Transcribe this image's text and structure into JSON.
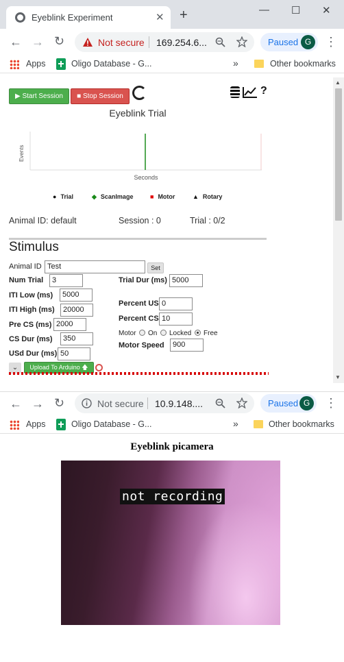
{
  "window1": {
    "tab_title": "Eyeblink Experiment",
    "tab_close": "✕",
    "new_tab": "+",
    "controls": {
      "minimize": "—",
      "maximize": "☐",
      "close": "✕"
    },
    "nav": {
      "back": "←",
      "forward": "→",
      "reload": "↻"
    },
    "omnibox": {
      "security_label": "Not secure",
      "url": "169.254.6..."
    },
    "profile": {
      "label": "Paused",
      "initial": "G"
    },
    "menu": "⋮",
    "bookmarks": {
      "apps": "Apps",
      "item1": "Oligo Database - G...",
      "overflow": "»",
      "other": "Other bookmarks"
    }
  },
  "app": {
    "start_label": "▶ Start Session",
    "stop_label": "■ Stop Session",
    "help": "?",
    "plot": {
      "title": "Eyeblink Trial",
      "ylabel": "Events",
      "xlabel": "Seconds",
      "legend": [
        "Trial",
        "ScanImage",
        "Motor",
        "Rotary"
      ],
      "legend_markers": [
        "●",
        "◆",
        "■",
        "▲"
      ],
      "legend_colors": [
        "#111111",
        "#1a8a1a",
        "#e00000",
        "#111111"
      ]
    },
    "status": {
      "animal": "Animal ID: default",
      "session": "Session : 0",
      "trial": "Trial : 0/2"
    },
    "stimulus": {
      "title": "Stimulus",
      "animal_id_label": "Animal ID",
      "animal_id_value": "Test",
      "set_label": "Set",
      "num_trial_label": "Num Trial",
      "num_trial_value": "3",
      "trial_dur_label": "Trial Dur (ms)",
      "trial_dur_value": "5000",
      "iti_low_label": "ITI Low (ms)",
      "iti_low_value": "5000",
      "iti_high_label": "ITI High (ms)",
      "iti_high_value": "20000",
      "percent_us_label": "Percent US",
      "percent_us_value": "0",
      "pre_cs_label": "Pre CS (ms)",
      "pre_cs_value": "2000",
      "percent_cs_label": "Percent CS",
      "percent_cs_value": "10",
      "cs_dur_label": "CS Dur (ms)",
      "cs_dur_value": "350",
      "motor_label": "Motor",
      "motor_on": "On",
      "motor_locked": "Locked",
      "motor_free": "Free",
      "motor_selected": "Free",
      "usd_dur_label": "USd Dur (ms)",
      "usd_dur_value": "50",
      "motor_speed_label": "Motor Speed",
      "motor_speed_value": "900",
      "chevron": "⌄",
      "upload_label": "Upload To Arduino 🡅"
    }
  },
  "window2": {
    "nav": {
      "back": "←",
      "forward": "→",
      "reload": "↻"
    },
    "omnibox": {
      "security_label": "Not secure",
      "url": "10.9.148...."
    },
    "profile": {
      "label": "Paused",
      "initial": "G"
    },
    "menu": "⋮",
    "bookmarks": {
      "apps": "Apps",
      "item1": "Oligo Database - G...",
      "overflow": "»",
      "other": "Other bookmarks"
    },
    "page_title": "Eyeblink picamera",
    "overlay": "not recording"
  }
}
